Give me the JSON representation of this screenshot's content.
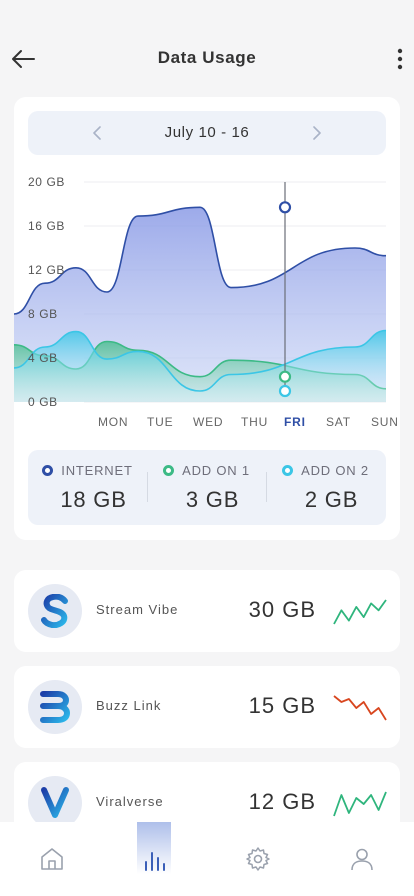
{
  "header": {
    "title": "Data Usage"
  },
  "date_range": {
    "label": "July 10 - 16"
  },
  "chart_data": {
    "type": "area",
    "categories": [
      "MON",
      "TUE",
      "WED",
      "THU",
      "FRI",
      "SAT",
      "SUN"
    ],
    "x": [
      0,
      0.5,
      1.0,
      1.5,
      2.0,
      2.5,
      3.0,
      3.5,
      4.0,
      4.5,
      5.0,
      5.5,
      6.0
    ],
    "y_ticks": [
      "20 GB",
      "16 GB",
      "12 GB",
      "8 GB",
      "4 GB",
      "0 GB"
    ],
    "ylim": [
      0,
      20
    ],
    "selected_category": "FRI",
    "series": [
      {
        "name": "INTERNET",
        "color": "#3b5fb8",
        "values": [
          8.0,
          10.8,
          12.2,
          10.0,
          16.9,
          17.7,
          10.4,
          14.0,
          13.3
        ]
      },
      {
        "name": "ADD ON 1",
        "color": "#3cba86",
        "values": [
          5.2,
          4.2,
          3.0,
          5.5,
          4.7,
          2.3,
          3.8,
          2.5,
          1.2
        ]
      },
      {
        "name": "ADD ON 2",
        "color": "#3bc6e6",
        "values": [
          3.1,
          5.0,
          6.4,
          3.9,
          4.6,
          1.0,
          2.5,
          5.0,
          6.5
        ]
      }
    ],
    "series_x": [
      0,
      0.5,
      1.0,
      1.5,
      2.0,
      3.0,
      3.5,
      5.5,
      6.0
    ],
    "grid": true,
    "highlight": {
      "category": "FRI",
      "values": [
        17.7,
        2.3,
        1.0
      ]
    }
  },
  "legend": [
    {
      "label": "INTERNET",
      "value": "18 GB",
      "color": "#2f4fa6"
    },
    {
      "label": "ADD ON 1",
      "value": "3 GB",
      "color": "#3cba86"
    },
    {
      "label": "ADD ON 2",
      "value": "2 GB",
      "color": "#3bc6e6"
    }
  ],
  "apps": [
    {
      "name": "Stream Vibe",
      "usage": "30 GB",
      "letter": "S",
      "trend": "up",
      "trend_color": "#2fb57d",
      "spark": [
        3,
        7,
        4,
        8,
        5,
        9,
        7,
        10
      ]
    },
    {
      "name": "Buzz Link",
      "usage": "15 GB",
      "letter": "B",
      "trend": "down",
      "trend_color": "#d8461f",
      "spark": [
        9,
        7,
        8,
        5,
        7,
        3,
        5,
        1
      ]
    },
    {
      "name": "Viralverse",
      "usage": "12 GB",
      "letter": "V",
      "trend": "up",
      "trend_color": "#2fb57d",
      "spark": [
        2,
        9,
        3,
        8,
        6,
        9,
        4,
        10
      ]
    }
  ],
  "nav": {
    "items": [
      "home-icon",
      "chart-icon",
      "settings-icon",
      "profile-icon"
    ],
    "active": "chart-icon"
  }
}
